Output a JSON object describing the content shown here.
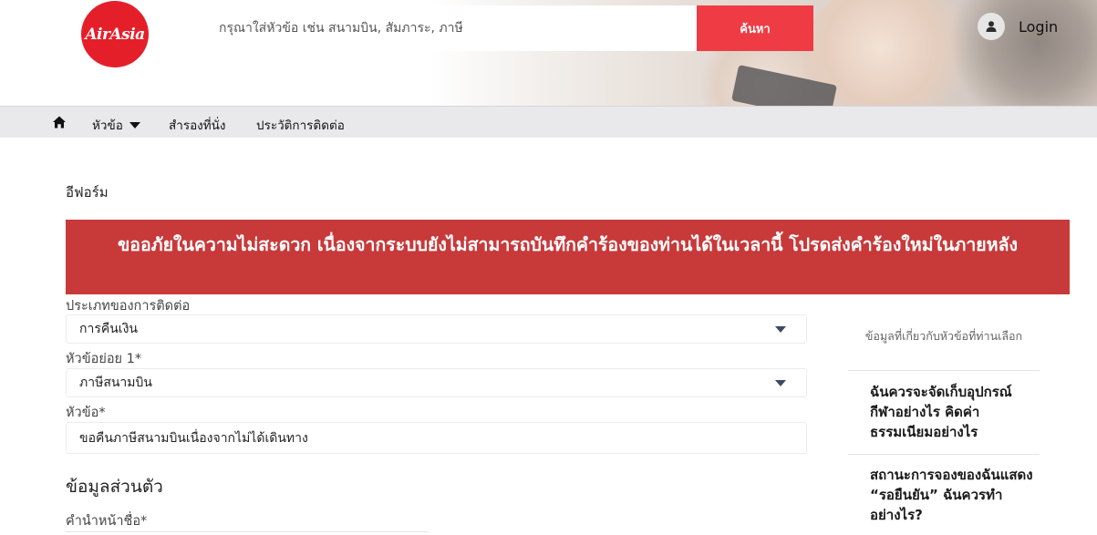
{
  "brand": {
    "logo_text": "AirAsia"
  },
  "search": {
    "placeholder": "กรุณาใส่หัวข้อ เช่น สนามบิน, สัมภาระ, ภาษี",
    "button_label": "ค้นหา"
  },
  "user": {
    "login_label": "Login"
  },
  "nav": {
    "topics_label": "หัวข้อ",
    "seat_label": "สำรองที่นั่ง",
    "history_label": "ประวัติการติดต่อ"
  },
  "page": {
    "title": "อีฟอร์ม",
    "error_message": "ขออภัยในความไม่สะดวก เนื่องจากระบบยังไม่สามารถบันทึกคำร้องของท่านได้ในเวลานี้ โปรดส่งคำร้องใหม่ในภายหลัง"
  },
  "form": {
    "contact_type": {
      "label": "ประเภทของการติดต่อ",
      "value": "การคืนเงิน"
    },
    "subtopic": {
      "label": "หัวข้อย่อย 1*",
      "value": "ภาษีสนามบิน"
    },
    "subject": {
      "label": "หัวข้อ*",
      "value": "ขอคืนภาษีสนามบินเนื่องจากไม่ได้เดินทาง"
    },
    "personal_section": "ข้อมูลส่วนตัว",
    "title_prefix": {
      "label": "คำนำหน้าชื่อ*"
    }
  },
  "sidebar": {
    "heading": "ข้อมูลที่เกี่ยวกับหัวข้อที่ท่านเลือก",
    "links": [
      "ฉันควรจะจัดเก็บอุปกรณ์กีฬาอย่างไร คิดค่าธรรมเนียมอย่างไร",
      "สถานะการจองของฉันแสดง “รอยืนยัน” ฉันควรทำอย่างไร?"
    ]
  },
  "colors": {
    "brand_red": "#e51f2a",
    "search_button": "#ef3b43",
    "error_banner": "#c8393a",
    "nav_bg": "#e9e9ec"
  }
}
